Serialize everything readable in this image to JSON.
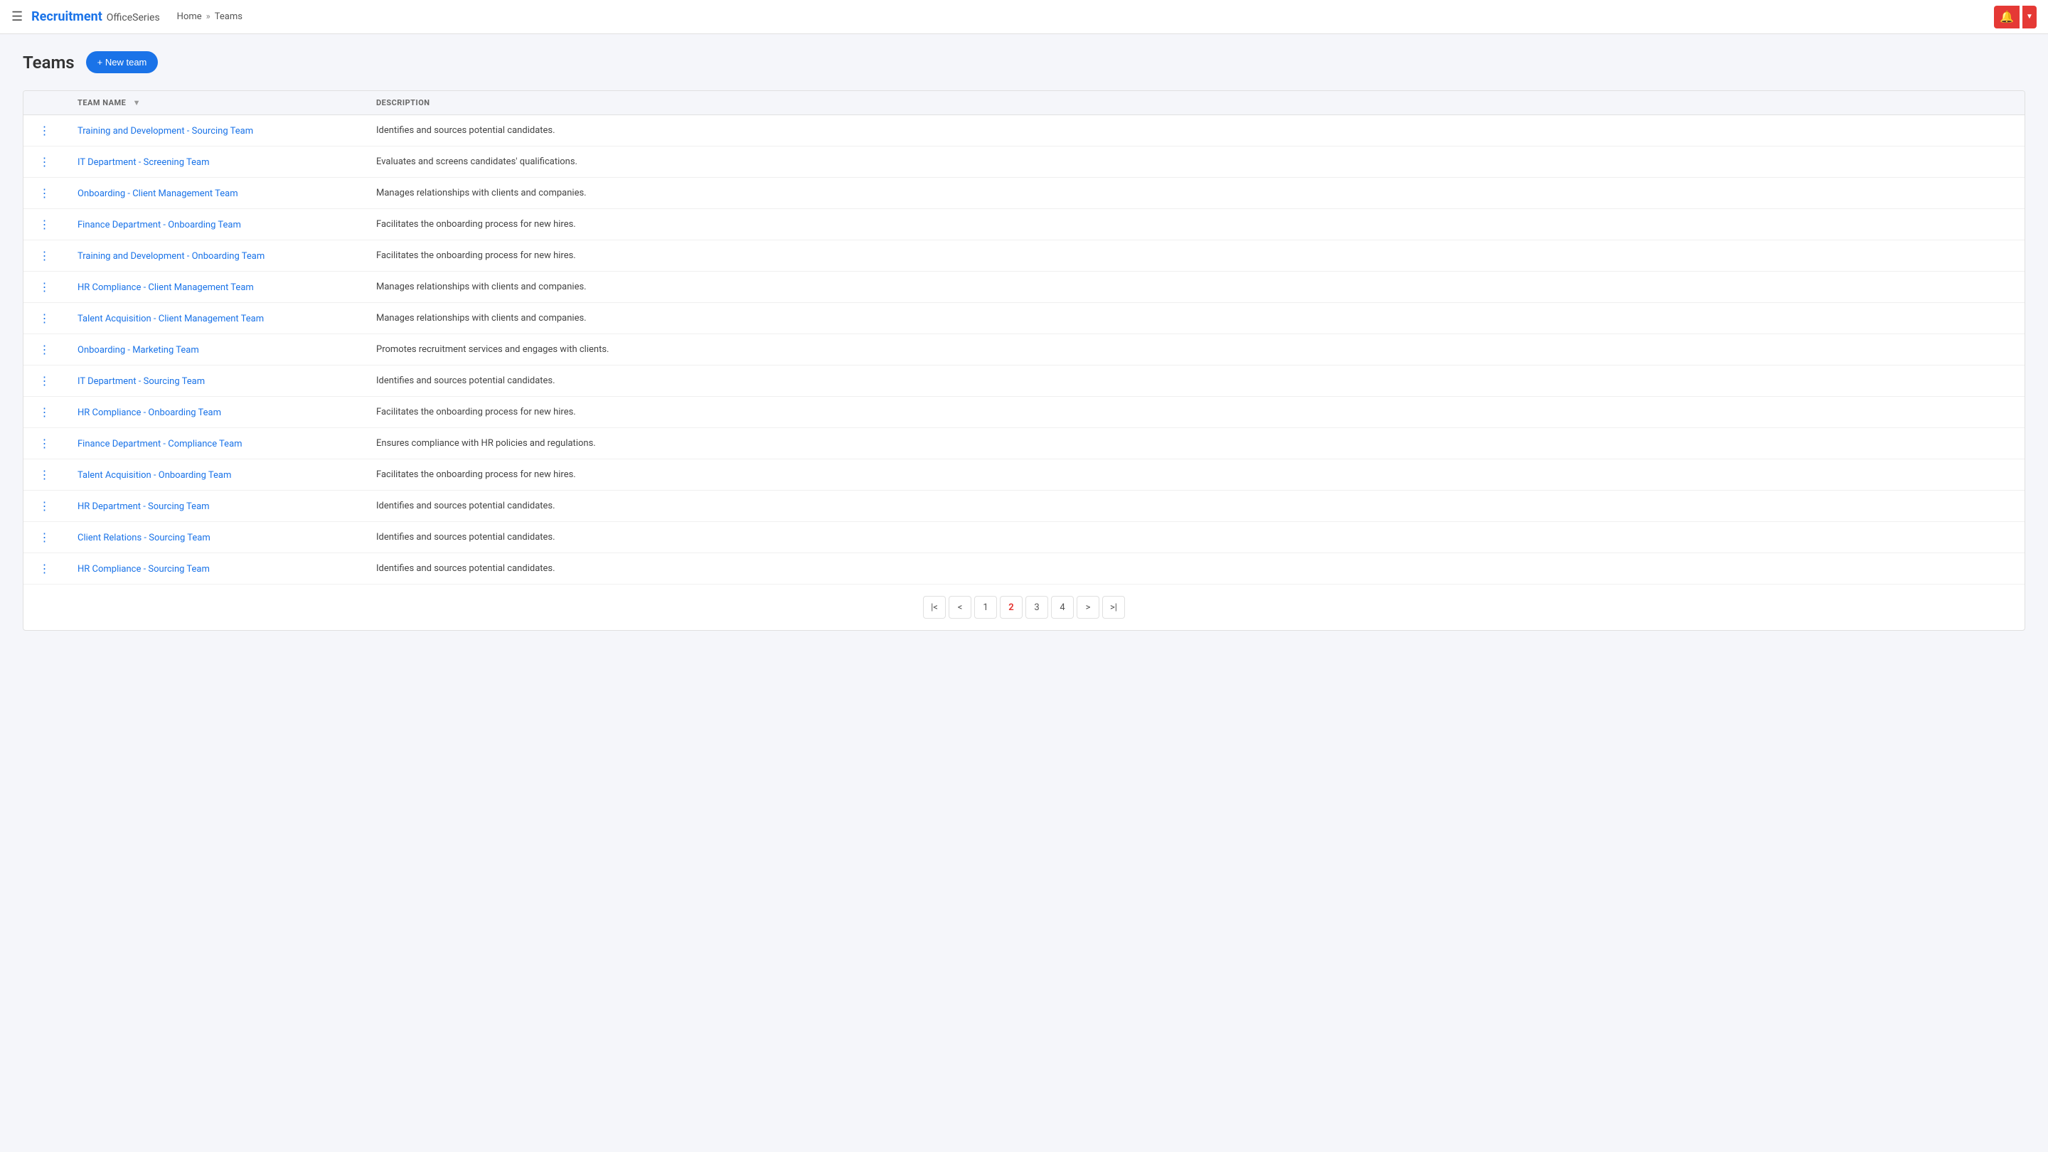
{
  "header": {
    "menu_icon": "☰",
    "brand_name": "Recruitment",
    "brand_sub": "OfficeSeries",
    "breadcrumb_home": "Home",
    "breadcrumb_sep": "»",
    "breadcrumb_current": "Teams",
    "notification_icon": "🔔",
    "dropdown_icon": "▼"
  },
  "page": {
    "title": "Teams",
    "new_team_btn": "+ New team"
  },
  "table": {
    "col_actions": "",
    "col_team_name": "TEAM NAME",
    "col_description": "DESCRIPTION",
    "rows": [
      {
        "name": "Training and Development - Sourcing Team",
        "description": "Identifies and sources potential candidates."
      },
      {
        "name": "IT Department - Screening Team",
        "description": "Evaluates and screens candidates' qualifications."
      },
      {
        "name": "Onboarding - Client Management Team",
        "description": "Manages relationships with clients and companies."
      },
      {
        "name": "Finance Department - Onboarding Team",
        "description": "Facilitates the onboarding process for new hires."
      },
      {
        "name": "Training and Development - Onboarding Team",
        "description": "Facilitates the onboarding process for new hires."
      },
      {
        "name": "HR Compliance - Client Management Team",
        "description": "Manages relationships with clients and companies."
      },
      {
        "name": "Talent Acquisition - Client Management Team",
        "description": "Manages relationships with clients and companies."
      },
      {
        "name": "Onboarding - Marketing Team",
        "description": "Promotes recruitment services and engages with clients."
      },
      {
        "name": "IT Department - Sourcing Team",
        "description": "Identifies and sources potential candidates."
      },
      {
        "name": "HR Compliance - Onboarding Team",
        "description": "Facilitates the onboarding process for new hires."
      },
      {
        "name": "Finance Department - Compliance Team",
        "description": "Ensures compliance with HR policies and regulations."
      },
      {
        "name": "Talent Acquisition - Onboarding Team",
        "description": "Facilitates the onboarding process for new hires."
      },
      {
        "name": "HR Department - Sourcing Team",
        "description": "Identifies and sources potential candidates."
      },
      {
        "name": "Client Relations - Sourcing Team",
        "description": "Identifies and sources potential candidates."
      },
      {
        "name": "HR Compliance - Sourcing Team",
        "description": "Identifies and sources potential candidates."
      }
    ]
  },
  "pagination": {
    "first": "|<",
    "prev": "<",
    "pages": [
      "1",
      "2",
      "3",
      "4"
    ],
    "current_page": "2",
    "next": ">",
    "last": ">|"
  }
}
